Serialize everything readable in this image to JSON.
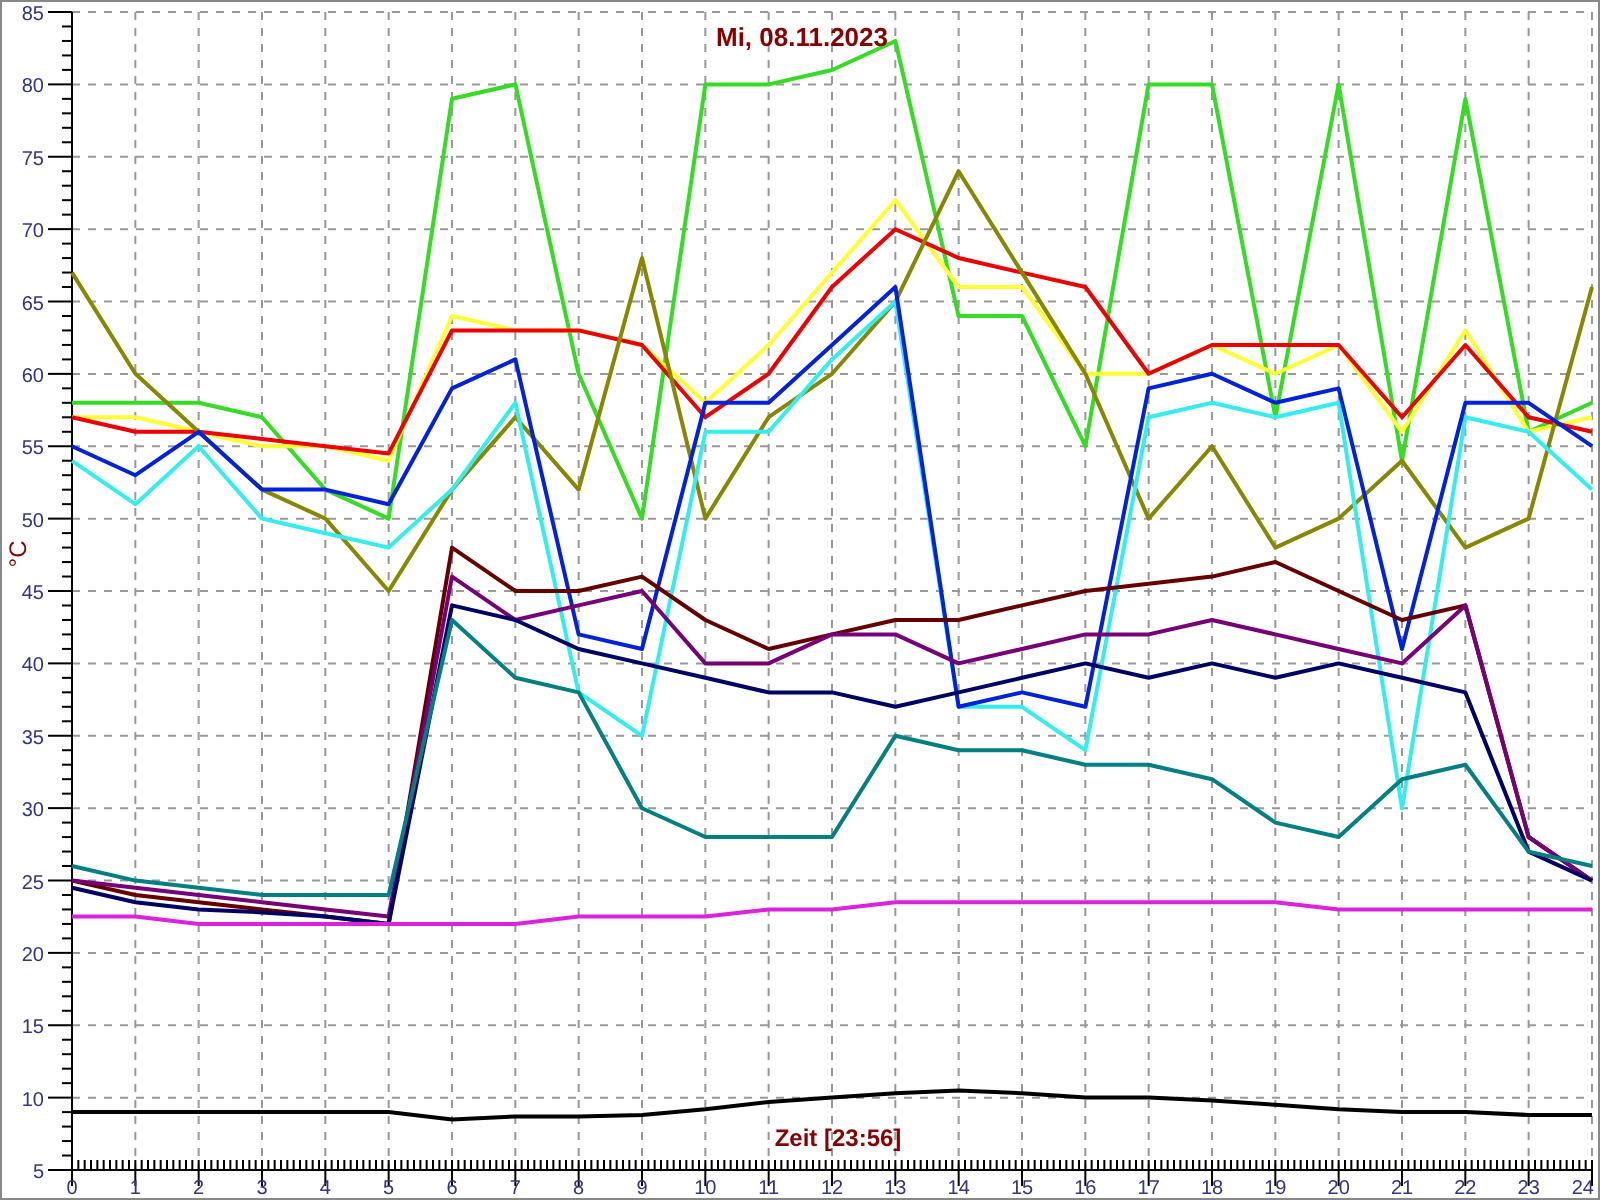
{
  "chart_data": {
    "type": "line",
    "title": "Mi, 08.11.2023",
    "xlabel": "Zeit [23:56]",
    "ylabel": "°C",
    "grid": true,
    "x": [
      0,
      1,
      2,
      3,
      4,
      5,
      6,
      7,
      8,
      9,
      10,
      11,
      12,
      13,
      14,
      15,
      16,
      17,
      18,
      19,
      20,
      21,
      22,
      23,
      24
    ],
    "xlim": [
      0,
      24
    ],
    "ylim": [
      5,
      85
    ],
    "xticks": [
      0,
      1,
      2,
      3,
      4,
      5,
      6,
      7,
      8,
      9,
      10,
      11,
      12,
      13,
      14,
      15,
      16,
      17,
      18,
      19,
      20,
      21,
      22,
      23,
      24
    ],
    "yticks": [
      5,
      10,
      15,
      20,
      25,
      30,
      35,
      40,
      45,
      50,
      55,
      60,
      65,
      70,
      75,
      80,
      85
    ],
    "series": [
      {
        "color": "#33dd22",
        "values": [
          58,
          58,
          58,
          57,
          52,
          50,
          79,
          80,
          60,
          50,
          80,
          80,
          81,
          83,
          64,
          64,
          55,
          80,
          80,
          57,
          80,
          54,
          79,
          56,
          58
        ]
      },
      {
        "color": "#ffff33",
        "values": [
          57,
          57,
          56,
          55,
          55,
          54,
          64,
          63,
          63,
          62,
          58,
          62,
          67,
          72,
          66,
          66,
          60,
          60,
          62,
          60,
          62,
          56,
          63,
          56,
          57
        ]
      },
      {
        "color": "#ee0000",
        "values": [
          57,
          56,
          56,
          55.5,
          55,
          54.5,
          63,
          63,
          63,
          62,
          57,
          60,
          66,
          70,
          68,
          67,
          66,
          60,
          62,
          62,
          62,
          57,
          62,
          57,
          56
        ]
      },
      {
        "color": "#888800",
        "values": [
          67,
          60,
          56,
          52,
          50,
          45,
          52,
          57,
          52,
          68,
          50,
          57,
          60,
          65,
          74,
          67,
          60,
          50,
          55,
          48,
          50,
          54,
          48,
          50,
          66
        ]
      },
      {
        "color": "#33eeee",
        "values": [
          54,
          51,
          55,
          50,
          49,
          48,
          52,
          58,
          38,
          35,
          56,
          56,
          61,
          65,
          37,
          37,
          34,
          57,
          58,
          57,
          58,
          30,
          57,
          56,
          52
        ]
      },
      {
        "color": "#0022dd",
        "values": [
          55,
          53,
          56,
          52,
          52,
          51,
          59,
          61,
          42,
          41,
          58,
          58,
          62,
          66,
          37,
          38,
          37,
          59,
          60,
          58,
          59,
          41,
          58,
          58,
          55
        ]
      },
      {
        "color": "#660000",
        "values": [
          25,
          24,
          23.5,
          23,
          22.5,
          22,
          48,
          45,
          45,
          46,
          43,
          41,
          42,
          43,
          43,
          44,
          45,
          45.5,
          46,
          47,
          45,
          43,
          44,
          28,
          25
        ]
      },
      {
        "color": "#770077",
        "values": [
          25,
          24.5,
          24,
          23.5,
          23,
          22.5,
          46,
          43,
          44,
          45,
          40,
          40,
          42,
          42,
          40,
          41,
          42,
          42,
          43,
          42,
          41,
          40,
          44,
          28,
          25
        ]
      },
      {
        "color": "#000066",
        "values": [
          24.5,
          23.5,
          23,
          22.8,
          22.5,
          22,
          44,
          43,
          41,
          40,
          39,
          38,
          38,
          37,
          38,
          39,
          40,
          39,
          40,
          39,
          40,
          39,
          38,
          27,
          25
        ]
      },
      {
        "color": "#008080",
        "values": [
          26,
          25,
          24.5,
          24,
          24,
          24,
          43,
          39,
          38,
          30,
          28,
          28,
          28,
          35,
          34,
          34,
          33,
          33,
          32,
          29,
          28,
          32,
          33,
          27,
          26
        ]
      },
      {
        "color": "#dd22dd",
        "values": [
          22.5,
          22.5,
          22,
          22,
          22,
          22,
          22,
          22,
          22.5,
          22.5,
          22.5,
          23,
          23,
          23.5,
          23.5,
          23.5,
          23.5,
          23.5,
          23.5,
          23.5,
          23,
          23,
          23,
          23,
          23
        ]
      },
      {
        "color": "#000000",
        "values": [
          9,
          9,
          9,
          9,
          9,
          9,
          8.5,
          8.7,
          8.7,
          8.8,
          9.2,
          9.7,
          10,
          10.3,
          10.5,
          10.3,
          10,
          10,
          9.8,
          9.5,
          9.2,
          9,
          9,
          8.8,
          8.8
        ]
      }
    ]
  }
}
